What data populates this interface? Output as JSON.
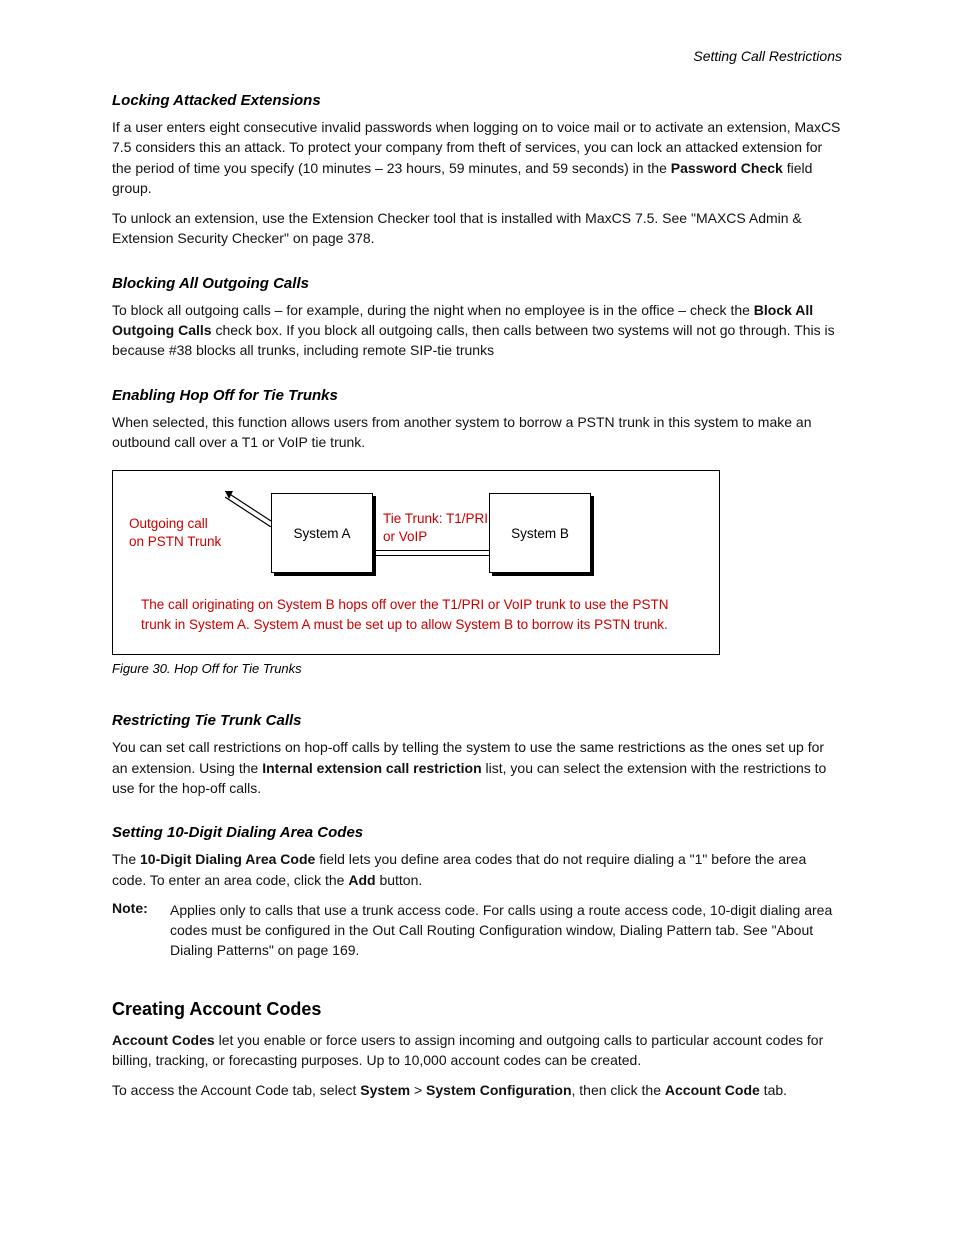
{
  "header": {
    "right": "Setting Call Restrictions"
  },
  "section_lock": {
    "heading": "Locking Attacked Extensions",
    "p1a": "If a user enters eight consecutive invalid passwords when logging on to voice mail or to activate an extension, MaxCS 7.5 considers this an attack. To protect your company from theft of services, you can lock an attacked extension for the period of time you specify (10 minutes – 23 hours, 59 minutes, and 59 seconds) in the ",
    "p1b": "Password Check",
    "p1c": " field group.",
    "p2": "To unlock an extension, use the Extension Checker tool that is installed with MaxCS 7.5. See \"MAXCS Admin & Extension Security Checker\" on page 378."
  },
  "section_block": {
    "heading": "Blocking All Outgoing Calls",
    "p1a": "To block all outgoing calls – for example, during the night when no employee is in the office – check the ",
    "p1b": "Block All Outgoing Calls",
    "p1c": " check box. If you block all outgoing calls, then calls between two systems will not go through. This is because #38 blocks all trunks, including remote SIP-tie trunks"
  },
  "section_hopoff": {
    "heading": "Enabling Hop Off for Tie Trunks",
    "p1": "When selected, this function allows users from another system to borrow a PSTN trunk in this system to make an outbound call over a T1 or VoIP tie trunk."
  },
  "figure": {
    "outgoing": "Outgoing call on PSTN Trunk",
    "sysA": "System A",
    "midlabel": "Tie Trunk: T1/PRI or VoIP",
    "sysB": "System B",
    "caption": "The call originating on System B hops off over the T1/PRI or VoIP trunk to use the PSTN trunk in System A. System A must be set up to allow System B to borrow its PSTN trunk.",
    "label": "Figure 30. Hop Off for Tie Trunks"
  },
  "section_restrict": {
    "heading": "Restricting Tie Trunk Calls",
    "p1a": "You can set call restrictions on hop-off calls by telling the system to use the same restrictions as the ones set up for an extension. Using the ",
    "p1b": "Internal extension call restriction",
    "p1c": " list, you can select the extension with the restrictions to use for the hop-off calls."
  },
  "section_tendigit": {
    "heading": "Setting 10-Digit Dialing Area Codes",
    "p1a": "The ",
    "p1b": "10-Digit Dialing Area Code",
    "p1c": " field lets you define area codes that do not require dialing a \"1\" before the area code. To enter an area code, click the ",
    "p1d": "Add",
    "p1e": " button.",
    "note_label": "Note:",
    "note_body": "Applies only to calls that use a trunk access code. For calls using a route access code, 10-digit dialing area codes must be configured in the Out Call Routing Configuration window, Dialing Pattern tab. See \"About Dialing Patterns\" on page 169."
  },
  "section_account": {
    "heading": "Creating Account Codes",
    "p1a": "Account Codes",
    "p1b": " let you enable or force users to assign incoming and outgoing calls to particular account codes for billing, tracking, or forecasting purposes. Up to 10,000 account codes can be created.",
    "p2a": "To access the Account Code tab, select ",
    "p2b": "System",
    "p2c": " > ",
    "p2d": "System Configuration",
    "p2e": ", then click the ",
    "p2f": "Account Code",
    "p2g": " tab."
  }
}
